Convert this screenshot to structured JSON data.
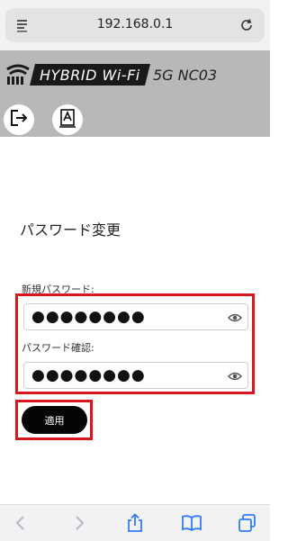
{
  "browser": {
    "url": "192.168.0.1",
    "reader_icon": "reader-mode-icon",
    "reload_icon": "reload-icon"
  },
  "header": {
    "brand_text": "HYBRID Wi-Fi",
    "model_text": "5G NC03",
    "logo_icon": "wifi-logo-icon",
    "logout_icon": "logout-icon",
    "account_icon": "account-icon"
  },
  "main": {
    "title": "パスワード変更",
    "new_password_label": "新規パスワード:",
    "new_password_value": "●●●●●●●●",
    "confirm_password_label": "パスワード確認:",
    "confirm_password_value": "●●●●●●●●",
    "apply_label": "適用",
    "eye_icon": "eye-icon",
    "highlight_color": "#d9161d"
  },
  "toolbar": {
    "back_icon": "back-arrow-icon",
    "forward_icon": "forward-arrow-icon",
    "share_icon": "share-icon",
    "bookmarks_icon": "bookmarks-icon",
    "tabs_icon": "tabs-icon"
  }
}
